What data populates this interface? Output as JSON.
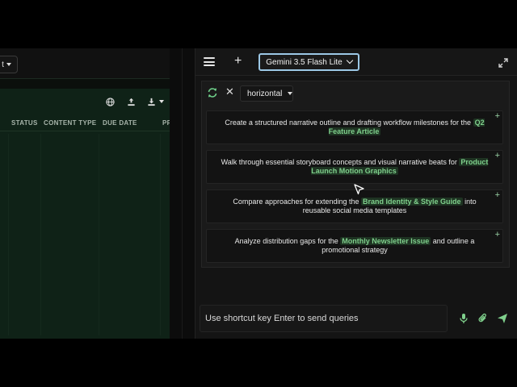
{
  "left_panel": {
    "dropdown_label": "t",
    "columns": [
      "STATUS",
      "CONTENT TYPE",
      "DUE DATE",
      "PR"
    ],
    "toolbar_icons": [
      "globe-icon",
      "upload-icon",
      "download-icon"
    ]
  },
  "header": {
    "model_label": "Gemini 3.5 Flash Lite"
  },
  "prompts": {
    "layout_label": "horizontal",
    "cards": [
      {
        "before": "Create a structured narrative outline and drafting workflow milestones for the ",
        "highlight": "Q2 Feature Article",
        "after": ""
      },
      {
        "before": "Walk through essential storyboard concepts and visual narrative beats for ",
        "highlight": "Product Launch Motion Graphics",
        "after": ""
      },
      {
        "before": "Compare approaches for extending the ",
        "highlight": "Brand Identity & Style Guide",
        "after": " into reusable social media templates"
      },
      {
        "before": "Analyze distribution gaps for the ",
        "highlight": "Monthly Newsletter Issue",
        "after": " and outline a promotional strategy"
      }
    ],
    "add_symbol": "+"
  },
  "composer": {
    "placeholder": "Use shortcut key Enter to send queries"
  },
  "colors": {
    "accent_green": "#7fd08c",
    "model_border": "#9cc8e6"
  }
}
